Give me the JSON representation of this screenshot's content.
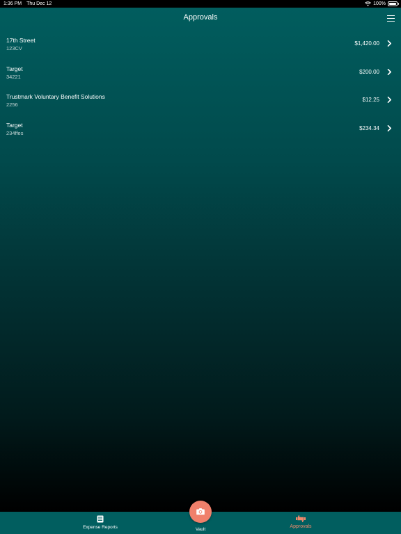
{
  "status_bar": {
    "time": "1:36 PM",
    "date": "Thu Dec 12",
    "battery": "100%",
    "icons": [
      "wifi-icon",
      "battery-icon"
    ]
  },
  "header": {
    "title": "Approvals",
    "menu_icon": "menu-icon"
  },
  "approvals": [
    {
      "name": "17th Street",
      "code": "123CV",
      "amount": "$1,420.00"
    },
    {
      "name": "Target",
      "code": "34221",
      "amount": "$200.00"
    },
    {
      "name": "Trustmark Voluntary Benefit Solutions",
      "code": "2256",
      "amount": "$12.25"
    },
    {
      "name": "Target",
      "code": "234ffes",
      "amount": "$234.34"
    }
  ],
  "tab_bar": {
    "tabs": [
      {
        "label": "Expense Reports",
        "icon": "document-icon",
        "active": false
      },
      {
        "label": "Vault",
        "icon": "camera-icon",
        "active": false
      },
      {
        "label": "Approvals",
        "icon": "thumbs-icon",
        "active": true
      }
    ]
  },
  "colors": {
    "header_teal": "#015e5f",
    "accent_orange": "#f0806b",
    "active_tab_text": "#f08a6c",
    "background_bottom": "#000000"
  }
}
